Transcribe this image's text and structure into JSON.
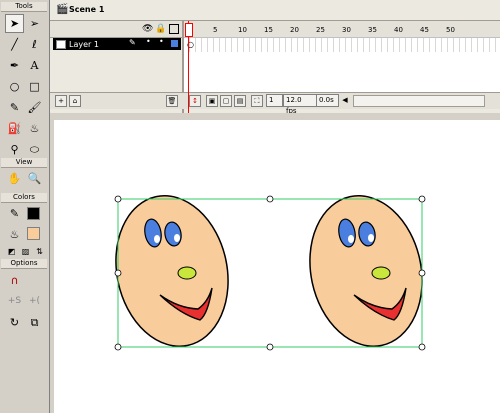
{
  "tools": {
    "title": "Tools",
    "view_title": "View",
    "colors_title": "Colors",
    "options_title": "Options"
  },
  "scene": {
    "label": "Scene 1"
  },
  "timeline": {
    "layer_name": "Layer 1",
    "frame_numbers": [
      "5",
      "10",
      "15",
      "20",
      "25",
      "30",
      "35",
      "40",
      "45",
      "50"
    ],
    "current_frame": "1",
    "fps": "12.0 fps",
    "time": "0.0s"
  },
  "colors": {
    "face_fill": "#f9cc9c",
    "eye_fill": "#4a7fe0",
    "nose_fill": "#c8e63c",
    "mouth_fill": "#e83030",
    "selection": "#33cc66"
  }
}
